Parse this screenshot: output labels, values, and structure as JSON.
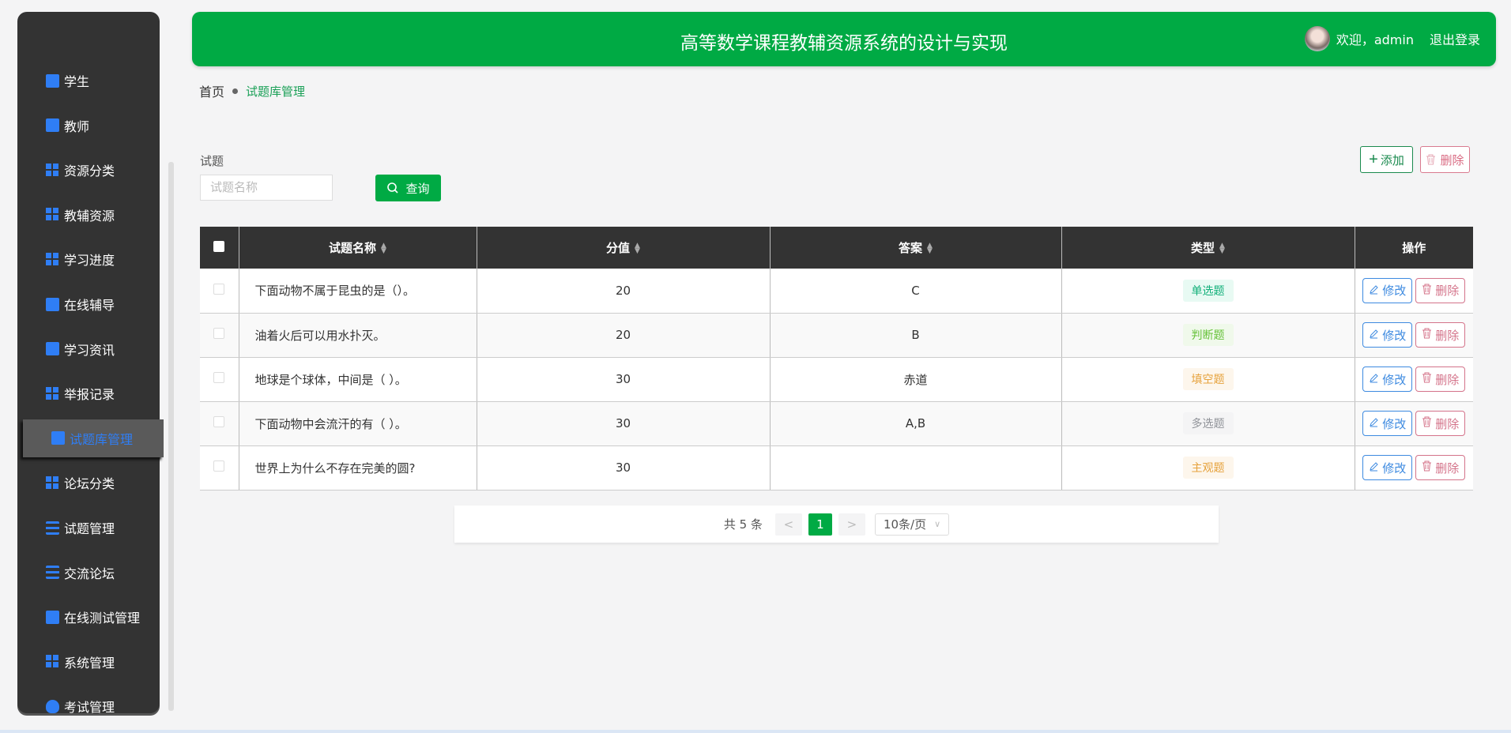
{
  "sidebar": {
    "items": [
      {
        "label": "学生",
        "icon": "briefcase-icon"
      },
      {
        "label": "教师",
        "icon": "monitor-icon"
      },
      {
        "label": "资源分类",
        "icon": "grid-icon"
      },
      {
        "label": "教辅资源",
        "icon": "grid-icon"
      },
      {
        "label": "学习进度",
        "icon": "grid-icon"
      },
      {
        "label": "在线辅导",
        "icon": "book-icon"
      },
      {
        "label": "学习资讯",
        "icon": "chat-icon"
      },
      {
        "label": "举报记录",
        "icon": "grid9-icon"
      },
      {
        "label": "试题库管理",
        "icon": "clipboard-check-icon",
        "active": true
      },
      {
        "label": "论坛分类",
        "icon": "grid-icon"
      },
      {
        "label": "试题管理",
        "icon": "sliders-icon"
      },
      {
        "label": "交流论坛",
        "icon": "list-icon"
      },
      {
        "label": "在线测试管理",
        "icon": "clipboard-icon"
      },
      {
        "label": "系统管理",
        "icon": "grid-icon"
      },
      {
        "label": "考试管理",
        "icon": "bulb-icon"
      }
    ]
  },
  "header": {
    "title": "高等数学课程教辅资源系统的设计与实现",
    "welcome": "欢迎，admin",
    "logout": "退出登录"
  },
  "breadcrumb": {
    "home": "首页",
    "current": "试题库管理"
  },
  "search": {
    "label": "试题",
    "placeholder": "试题名称",
    "button": "查询"
  },
  "actions": {
    "add": "添加",
    "delete": "删除"
  },
  "table": {
    "columns": [
      "试题名称",
      "分值",
      "答案",
      "类型",
      "操作"
    ],
    "rows": [
      {
        "name": "下面动物不属于昆虫的是（）。",
        "score": "20",
        "answer": "C",
        "type": "单选题",
        "color": "#13b07a",
        "bg": "#e8faf3"
      },
      {
        "name": "油着火后可以用水扑灭。",
        "score": "20",
        "answer": "B",
        "type": "判断题",
        "color": "#67c23a",
        "bg": "#f0f9eb"
      },
      {
        "name": "地球是个球体，中间是（ ）。",
        "score": "30",
        "answer": "赤道",
        "type": "填空题",
        "color": "#e6a23c",
        "bg": "#fdf6ec"
      },
      {
        "name": "下面动物中会流汗的有（ ）。",
        "score": "30",
        "answer": "A,B",
        "type": "多选题",
        "color": "#909399",
        "bg": "#f4f4f5"
      },
      {
        "name": "世界上为什么不存在完美的圆?",
        "score": "30",
        "answer": "",
        "type": "主观题",
        "color": "#e6a23c",
        "bg": "#fdf6ec"
      }
    ],
    "edit": "修改",
    "delete": "删除"
  },
  "pagination": {
    "total": "共 5 条",
    "prev": "<",
    "page": "1",
    "next": ">",
    "size": "10条/页"
  }
}
